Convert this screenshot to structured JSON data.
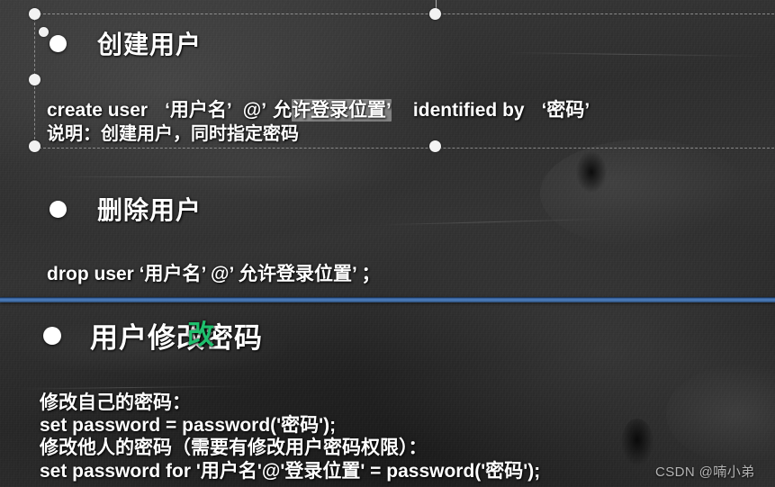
{
  "slide": {
    "background_color": "#2e2e2e",
    "divider_color": "#4d7fbe",
    "text_color": "#ffffff",
    "selection_highlight_color": "#b2b2b2",
    "cursor_color": "#1fbf6d"
  },
  "sections": {
    "create": {
      "heading": "创建用户",
      "code_prefix": "create   user",
      "code_user": "‘用户名’",
      "code_at": "@’",
      "code_host_plain": "允",
      "code_host_selected": "许登录位置’",
      "code_identified": "identified   by",
      "code_password": "‘密码’",
      "note": "说明：创建用户，同时指定密码"
    },
    "drop": {
      "heading": "删除用户",
      "code": "drop   user      ‘用户名’ @’  允许登录位置’     ；"
    },
    "modify": {
      "heading": "用户修改密码",
      "cursor_glyph": "改",
      "lines": [
        "修改自己的密码：",
        "set password = password('密码');",
        "修改他人的密码（需要有修改用户密码权限）：",
        "set password for '用户名'@'登录位置' = password('密码');"
      ]
    }
  },
  "selection": {
    "handle_count": 6,
    "border_style": "dashed"
  },
  "watermark": {
    "text": "CSDN @喃小弟"
  }
}
